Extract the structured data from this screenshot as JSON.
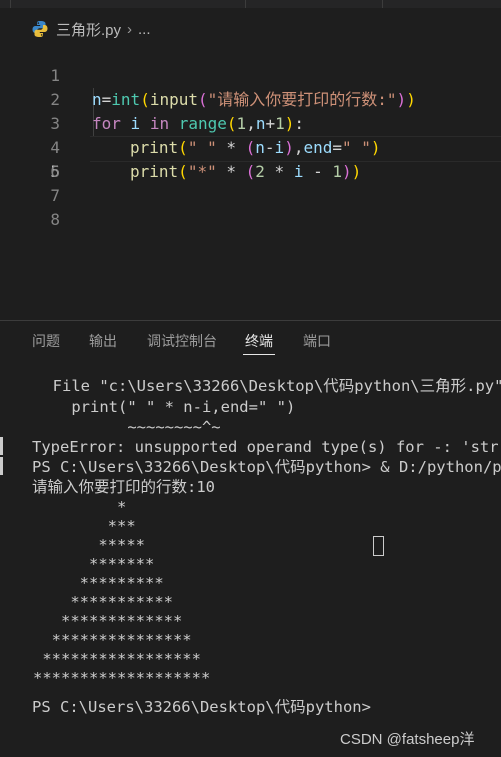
{
  "breadcrumb": {
    "file": "三角形.py",
    "more": "..."
  },
  "editor": {
    "line_numbers": [
      "1",
      "2",
      "3",
      "4",
      "5",
      "6",
      "7",
      "8"
    ],
    "active_line": "5",
    "code": {
      "l1": {
        "var": "n",
        "op": "=",
        "fn": "int",
        "p1": "(",
        "fn2": "input",
        "p2": "(",
        "str": "\"请输入你要打印的行数:\"",
        "p3": ")",
        "p4": ")"
      },
      "l2": {
        "kw1": "for",
        "var": "i",
        "kw2": "in",
        "fn": "range",
        "p1": "(",
        "num": "1",
        "sep": ",",
        "var2": "n",
        "op": "+",
        "num2": "1",
        "p2": ")",
        "colon": ":"
      },
      "l3": {
        "fn": "print",
        "p1": "(",
        "str": "\" \"",
        "op": " * ",
        "p2": "(",
        "var": "n",
        "op2": "-",
        "var2": "i",
        "p3": ")",
        "sep": ",",
        "var3": "end",
        "op3": "=",
        "str2": "\" \"",
        "p4": ")"
      },
      "l4": {
        "fn": "print",
        "p1": "(",
        "str": "\"*\"",
        "op": " * ",
        "p2": "(",
        "num": "2",
        "op2": " * ",
        "var": "i",
        "op3": " - ",
        "num2": "1",
        "p3": ")",
        "p4": ")"
      }
    }
  },
  "panel": {
    "tabs": [
      "问题",
      "输出",
      "调试控制台",
      "终端",
      "端口"
    ],
    "active_tab": "终端"
  },
  "terminal": {
    "lines": [
      "  File \"c:\\Users\\33266\\Desktop\\代码python\\三角形.py\"",
      "    print(\" \" * n-i,end=\" \")",
      "          ~~~~~~~~^~",
      "TypeError: unsupported operand type(s) for -: 'str'",
      "PS C:\\Users\\33266\\Desktop\\代码python> & ",
      "请输入你要打印的行数:10",
      "         *",
      "        ***",
      "       *****",
      "      *******",
      "     *********",
      "    ***********",
      "   *************",
      "  ***************",
      " *****************",
      "*******************",
      "PS C:\\Users\\33266\\Desktop\\代码python>"
    ],
    "command_path": "D:/python/py"
  },
  "watermark": "CSDN @fatsheep洋"
}
